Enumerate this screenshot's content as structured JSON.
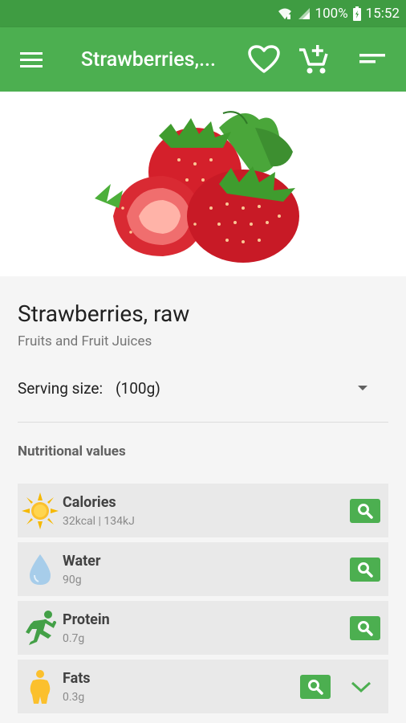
{
  "status_bar": {
    "battery": "100%",
    "time": "15:52"
  },
  "toolbar": {
    "title": "Strawberries,..."
  },
  "food": {
    "name": "Strawberries, raw",
    "category": "Fruits and Fruit Juices"
  },
  "serving": {
    "label": "Serving size:",
    "value": "(100g)"
  },
  "section_title": "Nutritional values",
  "nutrients": [
    {
      "name": "Calories",
      "value": "32kcal | 134kJ"
    },
    {
      "name": "Water",
      "value": "90g"
    },
    {
      "name": "Protein",
      "value": "0.7g"
    },
    {
      "name": "Fats",
      "value": "0.3g"
    }
  ],
  "colors": {
    "primary": "#4caf50",
    "primary_dark": "#3f9c42",
    "row_bg": "#e9e9e9"
  }
}
